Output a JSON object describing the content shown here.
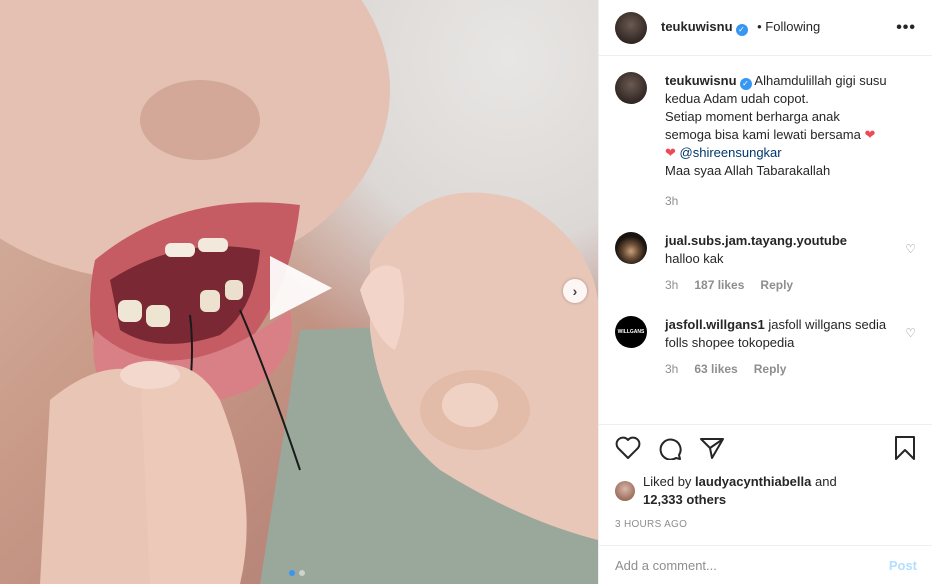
{
  "post": {
    "author": "teukuwisnu",
    "follow_status": "• Following",
    "more": "•••",
    "caption_lines": [
      "Alhamdulillah gigi susu",
      "kedua Adam udah copot.",
      "Setiap moment berharga anak",
      "semoga bisa kami lewati bersama"
    ],
    "mention": "@shireensungkar",
    "caption_last": "Maa syaa Allah Tabarakallah",
    "caption_time": "3h",
    "heart_emoji": "❤",
    "verified_mark": "✓"
  },
  "comments": [
    {
      "user": "jual.subs.jam.tayang.youtube",
      "text": "halloo kak",
      "time": "3h",
      "likes": "187 likes",
      "reply": "Reply"
    },
    {
      "user": "jasfoll.willgans1",
      "text": "jasfoll willgans sedia folls shopee tokopedia",
      "time": "3h",
      "likes": "63 likes",
      "reply": "Reply",
      "avatar_text": "WILLGANS"
    }
  ],
  "likes": {
    "prefix": "Liked by",
    "user": "laudyacynthiabella",
    "and": "and",
    "others": "12,333 others"
  },
  "timestamp": "3 HOURS AGO",
  "add_comment": {
    "placeholder": "Add a comment...",
    "post_label": "Post"
  },
  "media": {
    "next_glyph": "›"
  },
  "colors": {
    "link": "#00376b",
    "verified": "#3897f0",
    "muted": "#8e8e8e",
    "heart": "#ed4956"
  }
}
